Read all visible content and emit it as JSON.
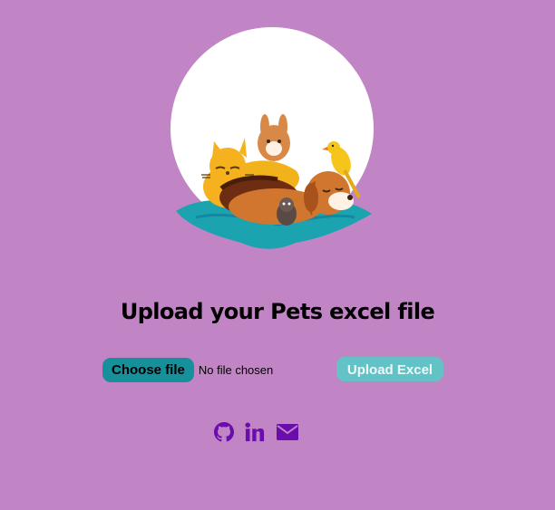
{
  "page": {
    "background": "#c185c6",
    "title": "Upload your Pets excel file"
  },
  "hero": {
    "image_name": "pets-illustration",
    "description_icon": "pets-on-cushion-illustration"
  },
  "upload_form": {
    "choose_button_label": "Choose file",
    "file_status": "No file chosen",
    "upload_button_label": "Upload Excel",
    "choose_button_color": "#16909b",
    "upload_button_color": "#63c2c6"
  },
  "social_links": [
    {
      "icon": "github-icon"
    },
    {
      "icon": "linkedin-icon"
    },
    {
      "icon": "envelope-icon"
    }
  ],
  "colors": {
    "icon": "#6a0dad"
  }
}
